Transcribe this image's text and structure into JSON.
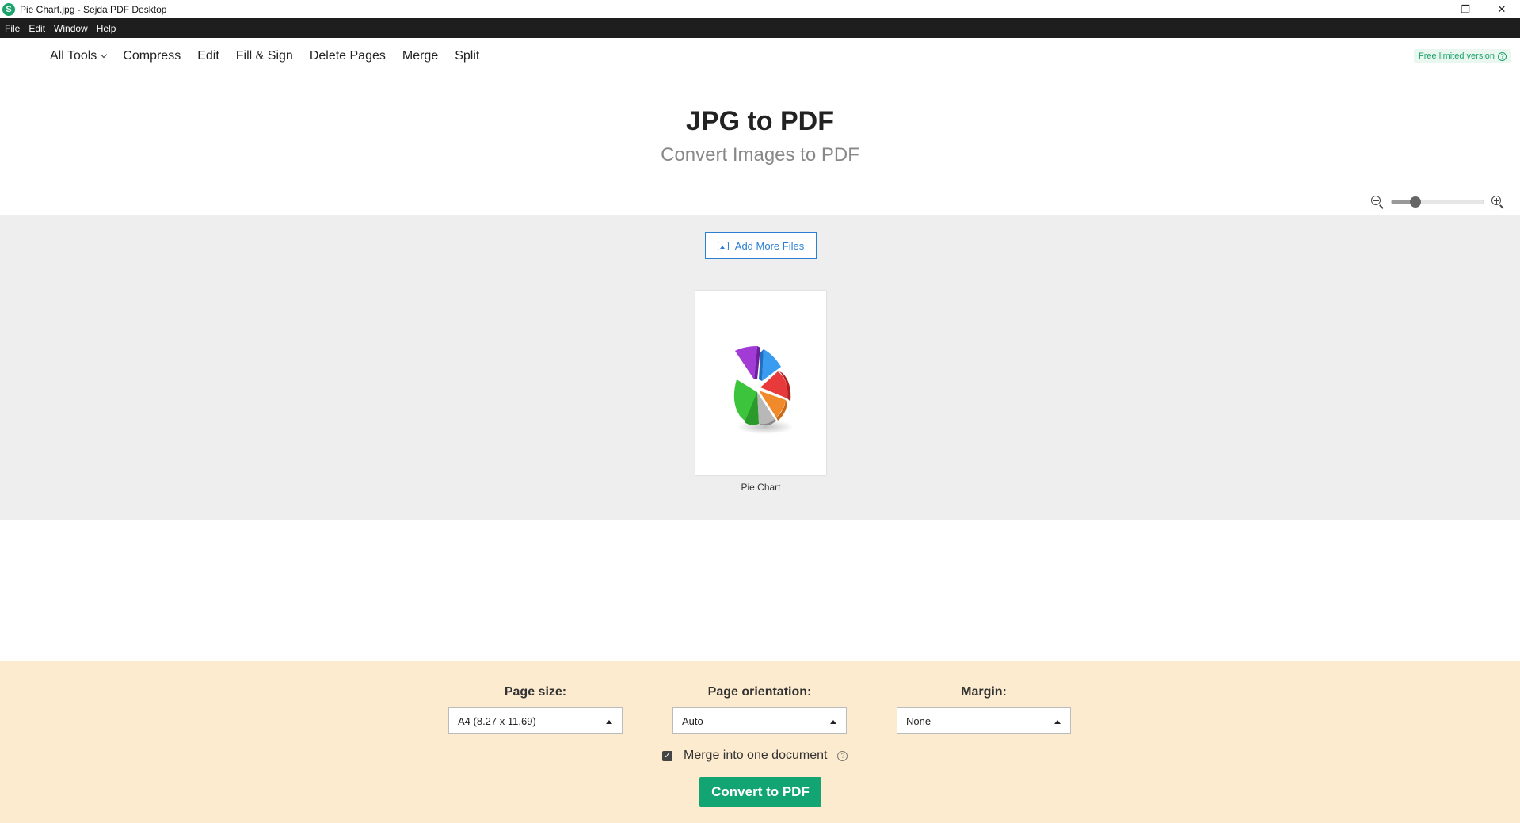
{
  "window": {
    "title": "Pie Chart.jpg - Sejda PDF Desktop",
    "logo_letter": "S",
    "controls": [
      "—",
      "❐",
      "✕"
    ]
  },
  "menubar": {
    "items": [
      "File",
      "Edit",
      "Window",
      "Help"
    ]
  },
  "toolnav": {
    "all_tools": "All Tools",
    "items": [
      "Compress",
      "Edit",
      "Fill & Sign",
      "Delete Pages",
      "Merge",
      "Split"
    ],
    "badge": "Free limited version",
    "badge_help": "?"
  },
  "page": {
    "title": "JPG to PDF",
    "subtitle": "Convert Images to PDF"
  },
  "zoom": {
    "level": 0.25
  },
  "files": {
    "add_button": "Add More Files",
    "items": [
      {
        "name": "Pie Chart"
      }
    ]
  },
  "options": {
    "page_size": {
      "label": "Page size:",
      "value": "A4 (8.27 x 11.69)"
    },
    "orientation": {
      "label": "Page orientation:",
      "value": "Auto"
    },
    "margin": {
      "label": "Margin:",
      "value": "None"
    },
    "merge": {
      "label": "Merge into one document",
      "checked": true,
      "help": "?"
    },
    "convert_button": "Convert to PDF"
  },
  "colors": {
    "accent_green": "#12a473",
    "link_blue": "#2a7fd4",
    "options_bg": "#fdebd0"
  }
}
